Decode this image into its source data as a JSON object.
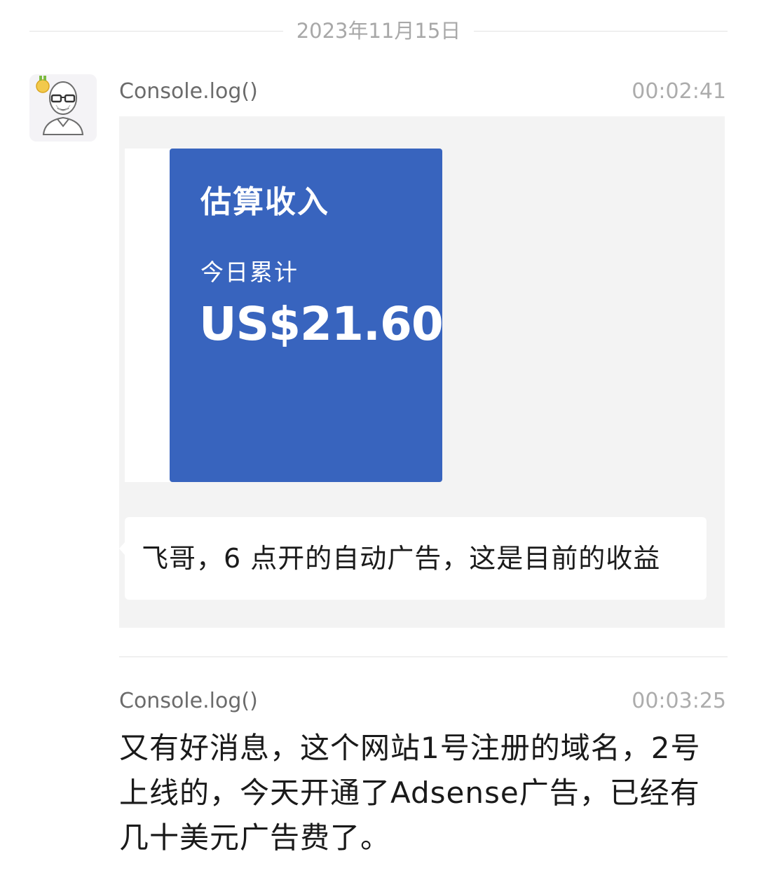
{
  "date_divider": {
    "date": "2023年11月15日"
  },
  "messages": [
    {
      "sender": "Console.log()",
      "time": "00:02:41",
      "avatar_icon": "bald-man-glasses-avatar-icon",
      "quote": {
        "screenshot": {
          "title": "估算收入",
          "subtitle": "今日累计",
          "amount": "US$21.60",
          "card_color": "#3864be"
        },
        "caption": "飞哥，6 点开的自动广告，这是目前的收益"
      }
    },
    {
      "sender": "Console.log()",
      "time": "00:03:25",
      "text": "又有好消息，这个网站1号注册的域名，2号上线的，今天开通了Adsense广告，已经有几十美元广告费了。"
    }
  ],
  "colors": {
    "background": "#ffffff",
    "quote_background": "#f3f3f3",
    "muted_text": "#acacac"
  }
}
